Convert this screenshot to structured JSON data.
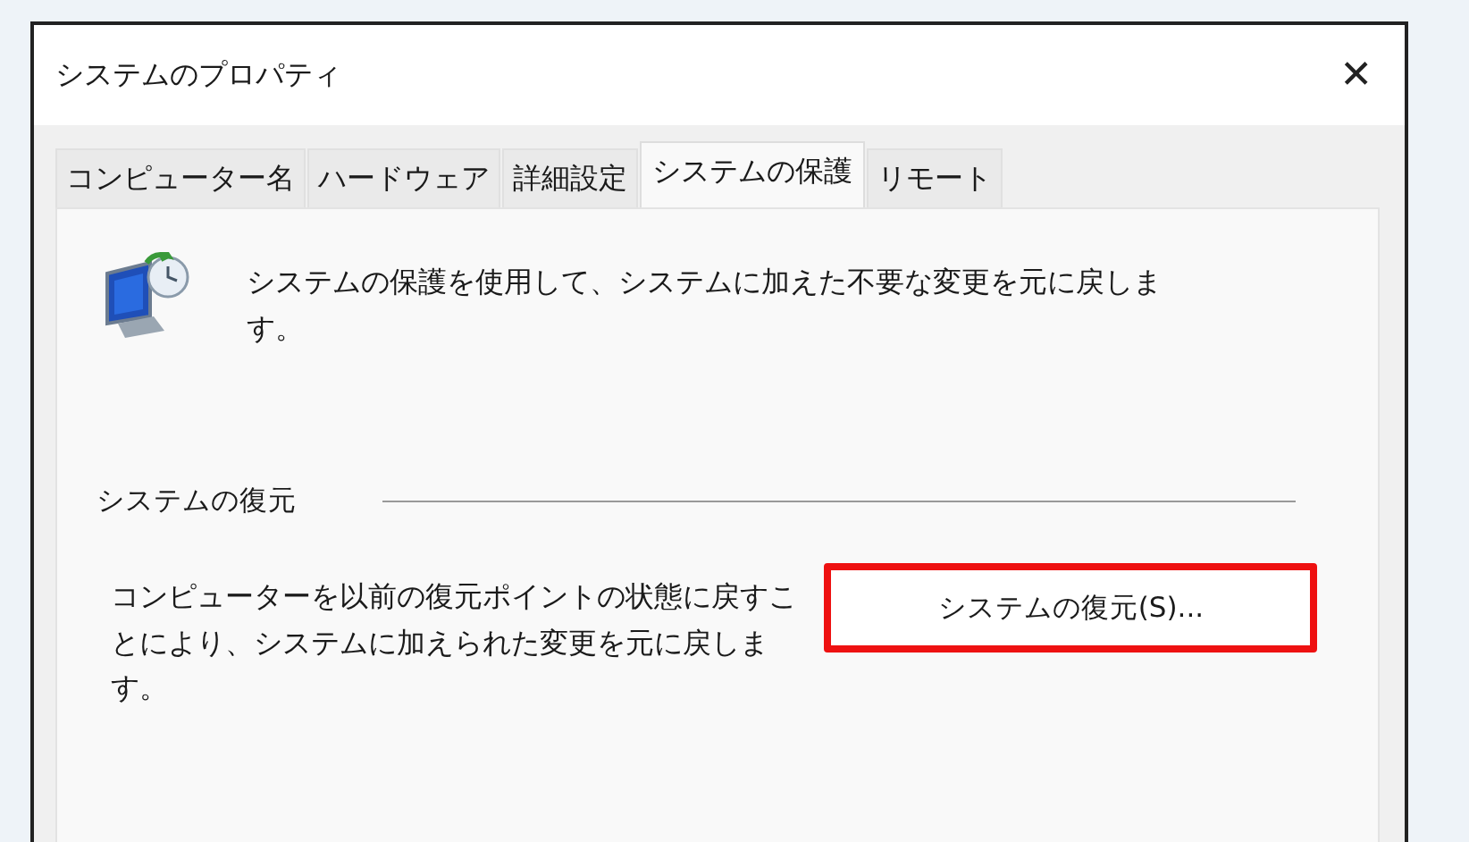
{
  "window": {
    "title": "システムのプロパティ",
    "close": "✕"
  },
  "tabs": [
    {
      "label": "コンピューター名",
      "selected": false
    },
    {
      "label": "ハードウェア",
      "selected": false
    },
    {
      "label": "詳細設定",
      "selected": false
    },
    {
      "label": "システムの保護",
      "selected": true
    },
    {
      "label": "リモート",
      "selected": false
    }
  ],
  "intro": "システムの保護を使用して、システムに加えた不要な変更を元に戻します。",
  "restore_group": {
    "title": "システムの復元",
    "description": "コンピューターを以前の復元ポイントの状態に戻すことにより、システムに加えられた変更を元に戻します。",
    "button": {
      "label": "システムの復元(S)...",
      "highlighted": true
    }
  }
}
